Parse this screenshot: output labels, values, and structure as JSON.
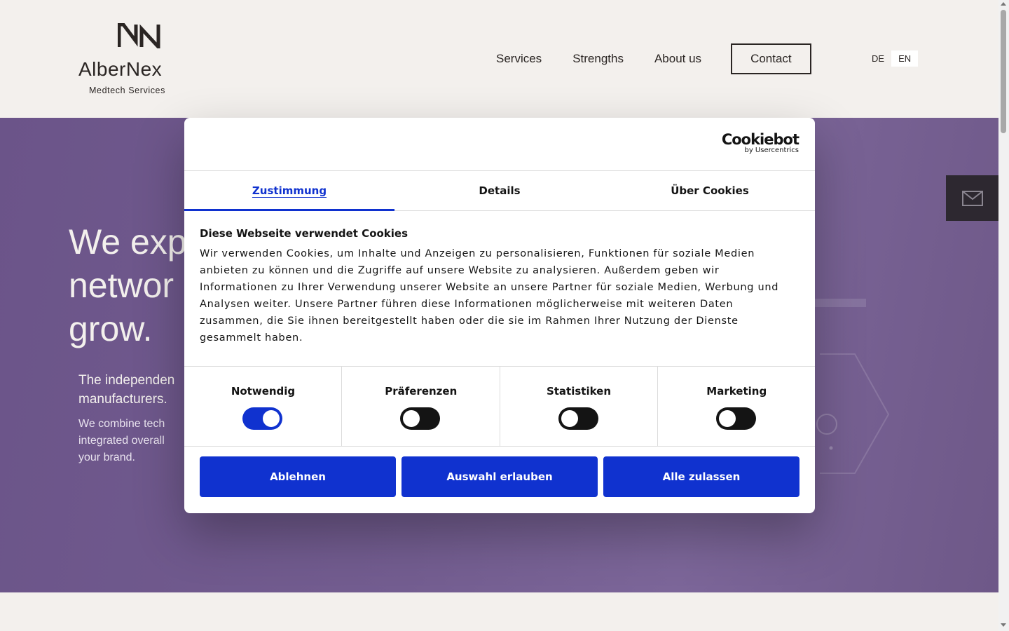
{
  "header": {
    "logo_name": "AlberNex",
    "logo_tagline": "Medtech Services",
    "nav": {
      "services": "Services",
      "strengths": "Strengths",
      "about": "About us",
      "contact": "Contact"
    },
    "languages": {
      "de": "DE",
      "en": "EN",
      "active": "EN"
    }
  },
  "hero": {
    "title_line1": "We exp",
    "title_line2": "networ",
    "title_line3": "grow.",
    "lead_line1": "The independen",
    "lead_line2": "manufacturers.",
    "body_line1": "We combine tech",
    "body_line2": "integrated overall",
    "body_line3": "your brand."
  },
  "side_contact": {
    "icon": "mail-icon"
  },
  "cookie_dialog": {
    "brand": "Cookiebot",
    "brand_by": "by Usercentrics",
    "tabs": {
      "consent": "Zustimmung",
      "details": "Details",
      "about": "Über Cookies",
      "active": "consent"
    },
    "heading": "Diese Webseite verwendet Cookies",
    "text_lines": [
      "Wir verwenden Cookies, um Inhalte und Anzeigen zu personalisieren, Funktionen für soziale Medien",
      "anbieten zu können und die Zugriffe auf unsere Website zu analysieren. Außerdem geben wir",
      "Informationen zu Ihrer Verwendung unserer Website an unsere Partner für soziale Medien, Werbung und",
      "Analysen weiter. Unsere Partner führen diese Informationen möglicherweise mit weiteren Daten",
      "zusammen, die Sie ihnen bereitgestellt haben oder die sie im Rahmen Ihrer Nutzung der Dienste",
      "gesammelt haben."
    ],
    "categories": {
      "necessary": {
        "label": "Notwendig",
        "enabled": true
      },
      "preferences": {
        "label": "Präferenzen",
        "enabled": false
      },
      "statistics": {
        "label": "Statistiken",
        "enabled": false
      },
      "marketing": {
        "label": "Marketing",
        "enabled": false
      }
    },
    "buttons": {
      "deny": "Ablehnen",
      "allow_selection": "Auswahl erlauben",
      "allow_all": "Alle zulassen"
    },
    "colors": {
      "accent": "#1032cf",
      "toggle_off": "#141414"
    }
  }
}
